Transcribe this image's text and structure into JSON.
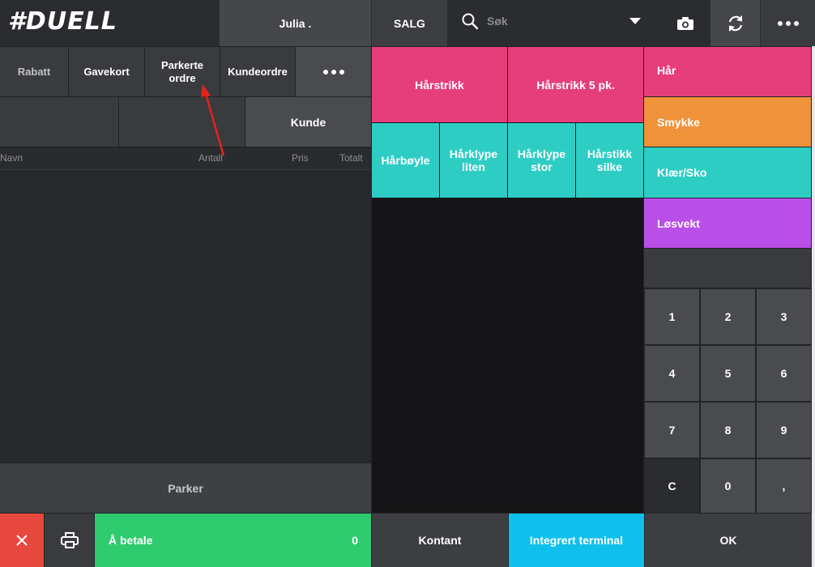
{
  "header": {
    "logo_text": "#DUELL",
    "user": "Julia .",
    "mode": "SALG",
    "search_placeholder": "Søk",
    "icons": [
      "search-icon",
      "chevron-down-icon",
      "camera-icon",
      "refresh-icon",
      "more-icon"
    ]
  },
  "actions": {
    "rabatt": "Rabatt",
    "gavekort": "Gavekort",
    "parkerte_line1": "Parkerte",
    "parkerte_line2": "ordre",
    "kundeordre": "Kundeordre",
    "more": "•••"
  },
  "kunde_label": "Kunde",
  "table": {
    "columns": [
      "Navn",
      "Antall",
      "Pris",
      "Totalt"
    ]
  },
  "bottom": {
    "parker": "Parker",
    "a_betale": "Å betale",
    "total": "0"
  },
  "products": {
    "row1": [
      "Hårstrikk",
      "Hårstrikk 5 pk."
    ],
    "row2": [
      {
        "l1": "Hårbøyle",
        "l2": ""
      },
      {
        "l1": "Hårklype",
        "l2": "liten"
      },
      {
        "l1": "Hårklype",
        "l2": "stor"
      },
      {
        "l1": "Hårstikk",
        "l2": "silke"
      }
    ]
  },
  "categories": [
    "Hår",
    "Smykke",
    "Klær/Sko",
    "Løsvekt"
  ],
  "keypad": [
    "1",
    "2",
    "3",
    "4",
    "5",
    "6",
    "7",
    "8",
    "9",
    "C",
    "0",
    ","
  ],
  "payment": {
    "kontant": "Kontant",
    "terminal": "Integrert terminal",
    "ok": "OK"
  },
  "colors": {
    "pink": "#e63e7b",
    "teal": "#2ecdc4",
    "orange": "#f0923a",
    "purple": "#b94ee8",
    "green": "#2fcb6f",
    "red": "#e8473e",
    "blue": "#10c0ec"
  }
}
